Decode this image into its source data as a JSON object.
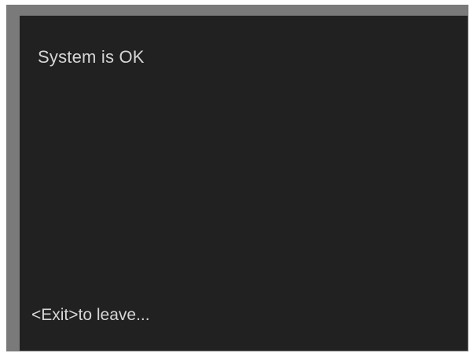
{
  "screen": {
    "status_message": "System is OK",
    "exit_hint": "<Exit>to leave..."
  },
  "colors": {
    "frame": "#7a7a7a",
    "screen_background": "#212121",
    "text": "#d6d6d6"
  }
}
